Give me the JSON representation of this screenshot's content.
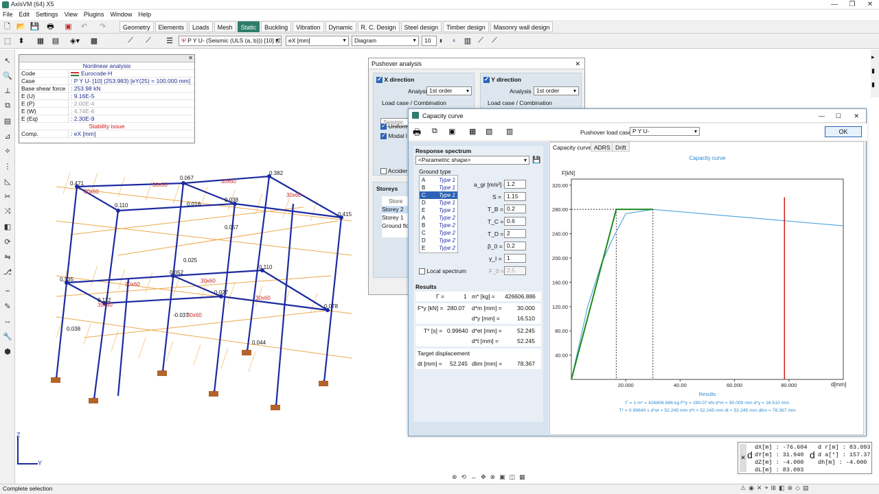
{
  "window": {
    "title": "AxisVM (64) X5",
    "controls": [
      "—",
      "❐",
      "✕"
    ]
  },
  "menu": [
    "File",
    "Edit",
    "Settings",
    "View",
    "Plugins",
    "Window",
    "Help"
  ],
  "ribbon_tabs": [
    {
      "label": "Geometry"
    },
    {
      "label": "Elements"
    },
    {
      "label": "Loads"
    },
    {
      "label": "Mesh"
    },
    {
      "label": "Static",
      "active": true
    },
    {
      "label": "Buckling"
    },
    {
      "label": "Vibration"
    },
    {
      "label": "Dynamic"
    },
    {
      "label": "R. C. Design"
    },
    {
      "label": "Steel design"
    },
    {
      "label": "Timber design"
    },
    {
      "label": "Masonry wall design"
    }
  ],
  "toolbar": {
    "load_case": "P Y U- (Seismic (ULS (a, b))) [10] (25",
    "component": "eX [mm]",
    "display_mode": "Diagram",
    "step": "10"
  },
  "info_panel": {
    "title": "Nonlinear analysis",
    "rows": [
      {
        "k": "Code",
        "v": "Eurocode-H",
        "flag": true
      },
      {
        "k": "Case",
        "v": ": P Y U- [10] (253.983) [eY(25) = 100.000 mm]"
      },
      {
        "k": "Base shear force",
        "v": ": 253.98 kN"
      },
      {
        "k": "E (U)",
        "v": ": 9.16E-5"
      },
      {
        "k": "E (P)",
        "v": ": 2.00E-4",
        "gray": true
      },
      {
        "k": "E (W)",
        "v": ": 4.74E-6",
        "gray": true
      },
      {
        "k": "E (Eq)",
        "v": ": 2.30E-9"
      }
    ],
    "stability": "Stability issue",
    "comp_k": "Comp.",
    "comp_v": ": eX [mm]"
  },
  "pushover": {
    "title": "Pushover analysis",
    "x_dir": "X direction",
    "y_dir": "Y direction",
    "analysis_label": "Analysis",
    "analysis_x": "1st order",
    "analysis_y": "1st order",
    "load_case_label": "Load case / Combination",
    "load_case_x": "Seismic",
    "uniform": "Uniform",
    "modal": "Modal l",
    "accidental": "Accider",
    "storeys": "Storeys",
    "storeys_col": "Store",
    "storey_list": [
      "Storey 2",
      "Storey 1",
      "Ground flo"
    ]
  },
  "capacity": {
    "title": "Capacity curve",
    "pushover_case_label": "Pushover load case",
    "pushover_case": "P Y U-",
    "ok": "OK",
    "response_spectrum": "Response spectrum",
    "spectrum_shape": "<Parametric shape>",
    "ground_type": "Ground type",
    "ground_types": [
      {
        "l": "A",
        "r": "Type 1"
      },
      {
        "l": "B",
        "r": "Type 1"
      },
      {
        "l": "C",
        "r": "Type 1",
        "sel": true
      },
      {
        "l": "D",
        "r": "Type 1"
      },
      {
        "l": "E",
        "r": "Type 1"
      },
      {
        "l": "A",
        "r": "Type 2"
      },
      {
        "l": "B",
        "r": "Type 2"
      },
      {
        "l": "C",
        "r": "Type 2"
      },
      {
        "l": "D",
        "r": "Type 2"
      },
      {
        "l": "E",
        "r": "Type 2"
      }
    ],
    "params": [
      {
        "label": "a_gr [m/s²] =",
        "value": "1.2"
      },
      {
        "label": "S =",
        "value": "1.15"
      },
      {
        "label": "T_B =",
        "value": "0.2"
      },
      {
        "label": "T_C =",
        "value": "0.6"
      },
      {
        "label": "T_D =",
        "value": "2"
      },
      {
        "label": "β_0 =",
        "value": "0.2"
      },
      {
        "label": "γ_I =",
        "value": "1"
      },
      {
        "label": "F_0 =",
        "value": "2.5",
        "disabled": true
      }
    ],
    "local_spectrum": "Local spectrum",
    "results_title": "Results",
    "results": {
      "gamma_l": "Γ =",
      "gamma_v": "1",
      "mstar_l": "m* [kg] =",
      "mstar_v": "426606.886",
      "fy_l": "F*y [kN] =",
      "fy_v": "280.07",
      "dm_l": "d*m [mm] =",
      "dm_v": "30.000",
      "dy_l": "d*y [mm] =",
      "dy_v": "16.510",
      "t_l": "T* [s] =",
      "t_v": "0.99640",
      "det_l": "d*et [mm] =",
      "det_v": "52.245",
      "dt_l": "d*t [mm] =",
      "dt_v": "52.245",
      "target": "Target displacement",
      "dtt_l": "dt [mm] =",
      "dtt_v": "52.245",
      "dlim_l": "dlim [mm] =",
      "dlim_v": "78.367"
    },
    "chart_tabs": [
      "Capacity curve",
      "ADRS",
      "Drift"
    ]
  },
  "chart_data": {
    "type": "line",
    "title": "Capacity curve",
    "xlabel": "d[mm]",
    "ylabel": "F[kN]",
    "xlim": [
      0,
      100
    ],
    "ylim": [
      0,
      330
    ],
    "x_ticks": [
      20,
      40,
      60,
      80
    ],
    "y_ticks": [
      40,
      80,
      120,
      160,
      200,
      240,
      280,
      320
    ],
    "x_tick_labels": [
      "20.000",
      "40.00",
      "60.000",
      "80.000"
    ],
    "y_tick_labels": [
      "40.00",
      "80.00",
      "120.00",
      "160.00",
      "200.00",
      "240.00",
      "280.00",
      "320.00"
    ],
    "series": [
      {
        "color": "#5aa8e0",
        "x": [
          0,
          6,
          11,
          15,
          20,
          30,
          100
        ],
        "y": [
          0,
          120,
          190,
          230,
          273,
          280,
          253
        ]
      },
      {
        "color": "#1d8a1d",
        "x": [
          0,
          16.51,
          30
        ],
        "y": [
          0,
          280.07,
          280.07
        ]
      }
    ],
    "dashed_guides": {
      "y": 280.07,
      "x": [
        16.51,
        30
      ]
    },
    "limit_line_x": 78.367,
    "results_label": "Results",
    "results_line1": "Γ = 1     m* = 426606.886 kg     F*y = 280.07 kN     d*m = 30.000 mm     d*y = 16.510 mm",
    "results_line2": "T* = 0.99640 s     d*et = 52.245 mm     d*t = 52.245 mm     dt = 52.245 mm     dlim = 78.367 mm"
  },
  "coords": {
    "dx": "dX[m]  : -76.604",
    "dy": "dY[m]  : 31.940",
    "dz": "dZ[m]  : -4.000",
    "dl": "dL[m]  : 83.093",
    "dr": "d r[m] : 83.093",
    "da": "d a[°] : 157.37",
    "dh": "dh[m]  : -4.000"
  },
  "status": "Complete selection",
  "axes": {
    "z": "Z",
    "y": "Y"
  }
}
